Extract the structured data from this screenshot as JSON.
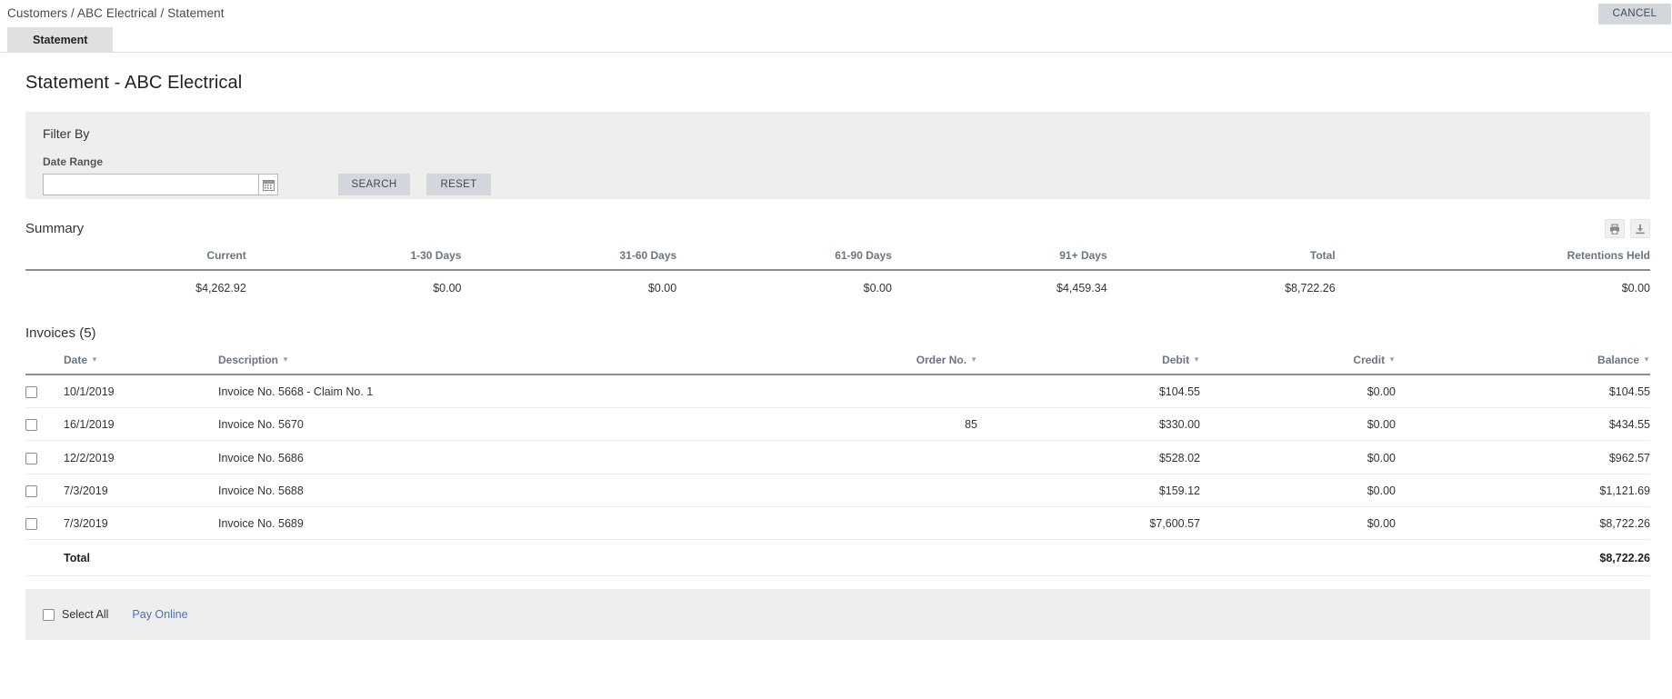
{
  "topbar": {
    "breadcrumb": "Customers / ABC Electrical / Statement",
    "cancel_label": "CANCEL"
  },
  "tabs": [
    {
      "label": "Statement",
      "active": true
    }
  ],
  "page_title": "Statement - ABC Electrical",
  "filter": {
    "title": "Filter By",
    "date_range_label": "Date Range",
    "date_range_value": "",
    "date_range_placeholder": "",
    "calendar_icon": "calendar-icon",
    "search_label": "SEARCH",
    "reset_label": "RESET"
  },
  "summary": {
    "title": "Summary",
    "print_icon": "print-icon",
    "download_icon": "download-icon",
    "columns": [
      "Current",
      "1-30 Days",
      "31-60 Days",
      "61-90 Days",
      "91+ Days",
      "Total",
      "Retentions Held"
    ],
    "values": [
      "$4,262.92",
      "$0.00",
      "$0.00",
      "$0.00",
      "$4,459.34",
      "$8,722.26",
      "$0.00"
    ]
  },
  "invoices": {
    "title": "Invoices (5)",
    "columns": [
      "Date",
      "Description",
      "Order No.",
      "Debit",
      "Credit",
      "Balance"
    ],
    "rows": [
      {
        "date": "10/1/2019",
        "description": "Invoice No. 5668 - Claim No. 1",
        "order_no": "",
        "debit": "$104.55",
        "credit": "$0.00",
        "balance": "$104.55"
      },
      {
        "date": "16/1/2019",
        "description": "Invoice No. 5670",
        "order_no": "85",
        "debit": "$330.00",
        "credit": "$0.00",
        "balance": "$434.55"
      },
      {
        "date": "12/2/2019",
        "description": "Invoice No. 5686",
        "order_no": "",
        "debit": "$528.02",
        "credit": "$0.00",
        "balance": "$962.57"
      },
      {
        "date": "7/3/2019",
        "description": "Invoice No. 5688",
        "order_no": "",
        "debit": "$159.12",
        "credit": "$0.00",
        "balance": "$1,121.69"
      },
      {
        "date": "7/3/2019",
        "description": "Invoice No. 5689",
        "order_no": "",
        "debit": "$7,600.57",
        "credit": "$0.00",
        "balance": "$8,722.26"
      }
    ],
    "total_label": "Total",
    "total_balance": "$8,722.26"
  },
  "footer": {
    "select_all_label": "Select All",
    "pay_online_label": "Pay Online"
  },
  "colors": {
    "button_grey": "#d3d6da",
    "panel_grey": "#eeeeee",
    "tab_grey": "#e0e0e0",
    "link_blue": "#4472c4",
    "header_text": "#6b7480"
  }
}
